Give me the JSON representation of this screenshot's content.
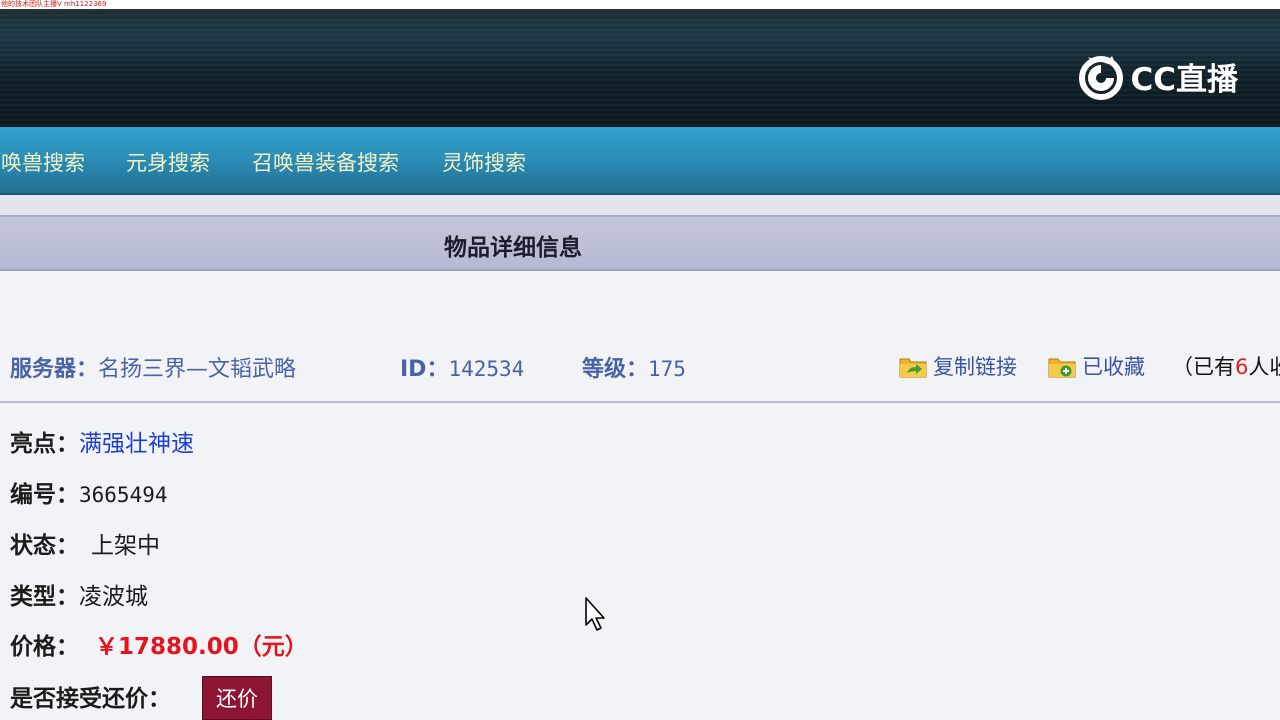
{
  "overlay": {
    "watermark": "他的技术团队主播V mh1122369"
  },
  "header": {
    "logo_text": "CC直播",
    "logo_icon": "cc-live-dragon-logo"
  },
  "nav": {
    "items": [
      {
        "label": "唤兽搜索"
      },
      {
        "label": "元身搜索"
      },
      {
        "label": "召唤兽装备搜索"
      },
      {
        "label": "灵饰搜索"
      }
    ]
  },
  "section": {
    "title": "物品详细信息"
  },
  "info": {
    "server_label": "服务器：",
    "server_value": "名扬三界—文韬武略",
    "id_label": "ID：",
    "id_value": "142534",
    "level_label": "等级：",
    "level_value": "175",
    "copy_link": "复制链接",
    "favorited": "已收藏",
    "fav_prefix": "（已有",
    "fav_count": "6",
    "fav_suffix": "人收"
  },
  "details": {
    "highlight_label": "亮点：",
    "highlight_value": "满强壮神速",
    "number_label": "编号：",
    "number_value": "3665494",
    "status_label": "状态：",
    "status_value": "上架中",
    "type_label": "类型：",
    "type_value": "凌波城",
    "price_label": "价格：",
    "price_value": "￥17880.00（元）",
    "counter_label": "是否接受还价：",
    "counter_button": "还价"
  },
  "colors": {
    "nav_text": "#f4f1c4",
    "info_blue": "#4a63a8",
    "highlight_blue": "#1d3fd6",
    "price_red": "#e3141c",
    "button_maroon": "#8c1533"
  }
}
